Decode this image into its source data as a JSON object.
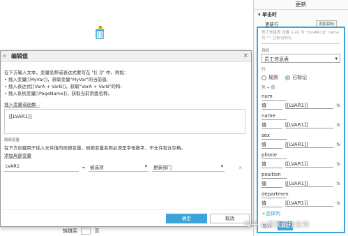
{
  "background": {
    "trash_badge": "7",
    "nav": {
      "goto": "转跳至",
      "page": "页"
    }
  },
  "right_panel": {
    "title": "更新",
    "subsection": "▾ 单击时",
    "update_row": {
      "label": "更新行",
      "add_target": "添加目标"
    },
    "desc": "员工信息表 设置 num 为 \"[[LVAR1]]\" name 为 \"\"; 已标记的行",
    "target_label": "目标",
    "target_value": "员工信息表",
    "row_label": "行",
    "radio_rule": "规则",
    "radio_marked": "已标记",
    "col_value_label": "列 + 值",
    "columns": [
      {
        "name": "num",
        "op": "值",
        "value": "[[LVAR1]]"
      },
      {
        "name": "name",
        "op": "值",
        "value": "[[LVAR1]]"
      },
      {
        "name": "sex",
        "op": "值",
        "value": "[[LVAR1]]"
      },
      {
        "name": "phone",
        "op": "值",
        "value": "[[LVAR1]]"
      },
      {
        "name": "position",
        "op": "值",
        "value": "[[LVAR1]]"
      },
      {
        "name": "departmen",
        "op": "值",
        "value": "[[LVAR1]]"
      }
    ],
    "fx": "fx",
    "add_column": "+选择列",
    "cancel": "取消",
    "ok": "确定"
  },
  "dialog": {
    "title": "编辑值",
    "close": "×",
    "instructions": [
      "在下方输入文本，变量名称或表达式要写在 \"[[ ]]\" 中。例如：",
      "• 插入变量[[MyVar]]，获取变量\"MyVar\"的当前值;",
      "• 插入表达式[[VarA + VarB]]，获取\"VarA + VarB\"的和;",
      "• 插入系统变量[[PageName]]，获取当前页面名称。"
    ],
    "insert_link": "插入变量或函数...",
    "textarea_value": "[[LVAR1]]",
    "local_section": "局部变量",
    "local_desc": "在下方创建用于插入元件值的局部变量，局部变量名称必须是字母数字，不允许包含空格。",
    "add_local": "添加局部变量",
    "var": {
      "name": "LVAR1",
      "eq": "=",
      "type": "被选项",
      "target": "更新部门",
      "remove": "×"
    },
    "ok": "确定",
    "cancel": "取消"
  },
  "watermark": "知乎 @看我倒挂金钩"
}
